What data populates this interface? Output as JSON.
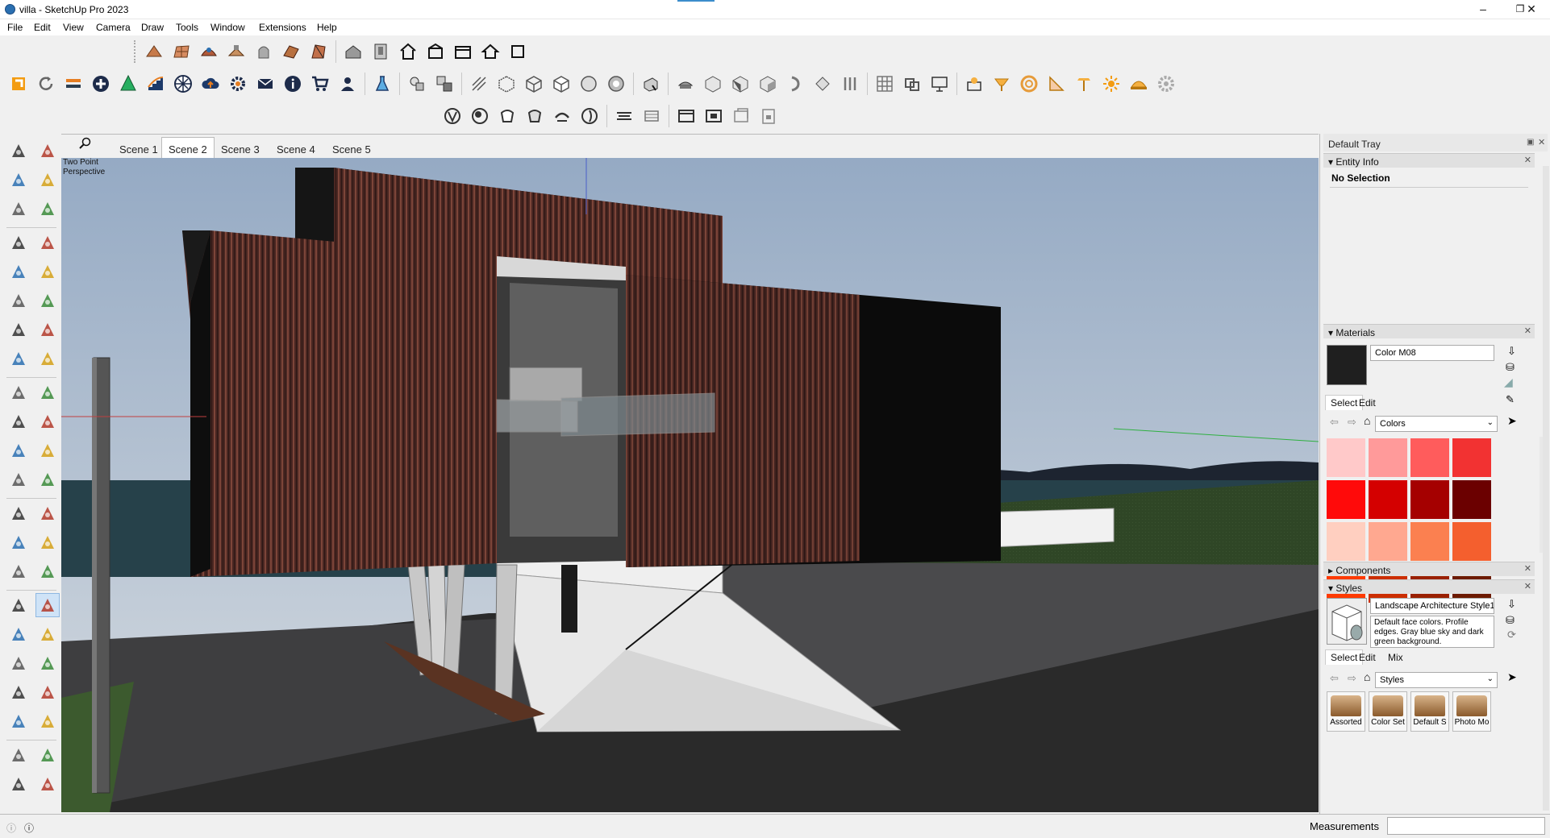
{
  "window": {
    "title": "villa - SketchUp Pro 2023",
    "minimize": "–",
    "maximize": "❐",
    "close": "✕"
  },
  "menu": [
    "File",
    "Edit",
    "View",
    "Camera",
    "Draw",
    "Tools",
    "Window",
    "Extensions",
    "Help"
  ],
  "toolbar_icons": {
    "row1": [
      "sandbox-from-contours-icon",
      "sandbox-from-scratch-icon",
      "smoove-icon",
      "stamp-icon",
      "drape-icon",
      "add-detail-icon",
      "flip-edge-icon",
      "warehouse-model-icon",
      "door-window-icon",
      "house-icon",
      "building-icon",
      "building2-icon",
      "home-icon",
      "square-icon"
    ],
    "row2": [
      "sketchup-logo-icon",
      "refresh-icon",
      "transfer-icon",
      "plus-circle-icon",
      "tree-icon",
      "stairs-icon",
      "pattern-icon",
      "cloud-upload-icon",
      "gear-plugin-icon",
      "mail-icon",
      "info-icon",
      "cart-icon",
      "user-icon",
      "flask-icon",
      "section-plane-icon",
      "section-fill-icon",
      "xray-icon",
      "back-edges-icon",
      "wireframe-icon",
      "hidden-line-icon",
      "shaded-icon",
      "textured-icon",
      "monochrome-icon",
      "iso-view-icon",
      "top-view-icon",
      "front-view-icon",
      "right-view-icon",
      "back-view-icon",
      "left-view-icon",
      "bottom-view-icon",
      "grid-icon",
      "match-photo-icon",
      "presentation-icon",
      "light-icon",
      "lamp-icon",
      "ring-icon",
      "triangle-icon",
      "parasol-icon",
      "sun-icon",
      "hat-icon",
      "gear-icon"
    ],
    "row3": [
      "outer-shell-icon",
      "intersect-icon",
      "union-icon",
      "subtract-icon",
      "trim-icon",
      "split-icon",
      "section-cut-icon",
      "section-display-icon",
      "window-frame-icon",
      "window-frame2-icon",
      "window-frame3-icon",
      "lock-frame-icon"
    ]
  },
  "left_tool_icons": [
    "select-icon",
    "orbit-small-icon",
    "paint-bucket-icon",
    "eraser-icon",
    "component-icon",
    "tag-icon",
    "line-icon",
    "freehand-icon",
    "rectangle-icon",
    "rotated-rectangle-icon",
    "circle-icon",
    "polygon-icon",
    "arc-icon",
    "two-point-arc-icon",
    "three-point-arc-icon",
    "pie-icon",
    "move-icon",
    "push-pull-icon",
    "rotate-icon",
    "follow-me-icon",
    "scale-icon",
    "offset-icon",
    "flip-icon",
    "solid-tools-icon",
    "tape-measure-icon",
    "dimension-icon",
    "protractor-icon",
    "text-icon",
    "axes-icon",
    "3d-text-icon",
    "orbit-icon",
    "pan-icon",
    "zoom-icon",
    "zoom-window-icon",
    "zoom-extents-icon",
    "previous-view-icon",
    "position-camera-icon",
    "walk-icon",
    "look-around-icon",
    "section-plane-tool-icon",
    "layers-icon",
    "sandbox-icon",
    "layer-stack-icon",
    "contours-icon"
  ],
  "scenes": {
    "tabs": [
      "Scene 1",
      "Scene 2",
      "Scene 3",
      "Scene 4",
      "Scene 5"
    ],
    "active": "Scene 2"
  },
  "viewport": {
    "camera_label_line1": "Two Point",
    "camera_label_line2": "Perspective"
  },
  "tray": {
    "title": "Default Tray",
    "entity_info": {
      "header": "Entity Info",
      "selection": "No Selection"
    },
    "materials": {
      "header": "Materials",
      "current_name": "Color M08",
      "current_color": "#1f1f1f",
      "tabs": [
        "Select",
        "Edit"
      ],
      "library": "Colors",
      "swatches": [
        "#ffc9c9",
        "#ff9a9a",
        "#ff5c5c",
        "#f23232",
        "#ff0a0a",
        "#d40000",
        "#a50000",
        "#6b0000",
        "#ffcfc0",
        "#ffa890",
        "#fb8050",
        "#f45f2e",
        "#ff3a00",
        "#cc2e00",
        "#9a2000",
        "#6c1a00"
      ]
    },
    "components": {
      "header": "Components"
    },
    "styles": {
      "header": "Styles",
      "name": "Landscape Architecture Style1",
      "description": "Default face colors. Profile edges. Gray blue sky and dark green background.",
      "tabs": [
        "Select",
        "Edit",
        "Mix"
      ],
      "library": "Styles",
      "items": [
        "Assorted",
        "Color Set",
        "Default S",
        "Photo Mo"
      ]
    }
  },
  "statusbar": {
    "measurements_label": "Measurements",
    "measurements_value": ""
  }
}
